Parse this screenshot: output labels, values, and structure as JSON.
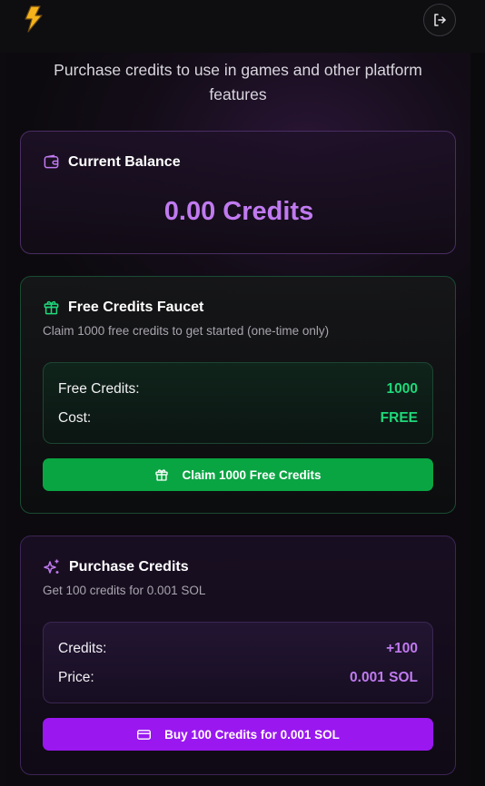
{
  "header": {
    "logo_icon": "lightning-bolt-icon",
    "logout_icon": "logout-icon"
  },
  "page": {
    "subtitle": "Purchase credits to use in games and other platform features"
  },
  "balance_card": {
    "icon": "wallet-icon",
    "title": "Current Balance",
    "value": "0.00 Credits",
    "accent": "#c07af0"
  },
  "faucet_card": {
    "icon": "gift-icon",
    "title": "Free Credits Faucet",
    "description": "Claim 1000 free credits to get started (one-time only)",
    "rows": [
      {
        "label": "Free Credits:",
        "value": "1000"
      },
      {
        "label": "Cost:",
        "value": "FREE"
      }
    ],
    "button_label": "Claim 1000 Free Credits",
    "accent": "#1fd87a",
    "button_color": "#0aa543"
  },
  "purchase_card": {
    "icon": "sparkles-icon",
    "title": "Purchase Credits",
    "description": "Get 100 credits for 0.001 SOL",
    "rows": [
      {
        "label": "Credits:",
        "value": "+100"
      },
      {
        "label": "Price:",
        "value": "0.001 SOL"
      }
    ],
    "button_label": "Buy 100 Credits for 0.001 SOL",
    "button_icon": "credit-card-icon",
    "accent": "#c07af0",
    "button_color": "#9a17f0"
  }
}
